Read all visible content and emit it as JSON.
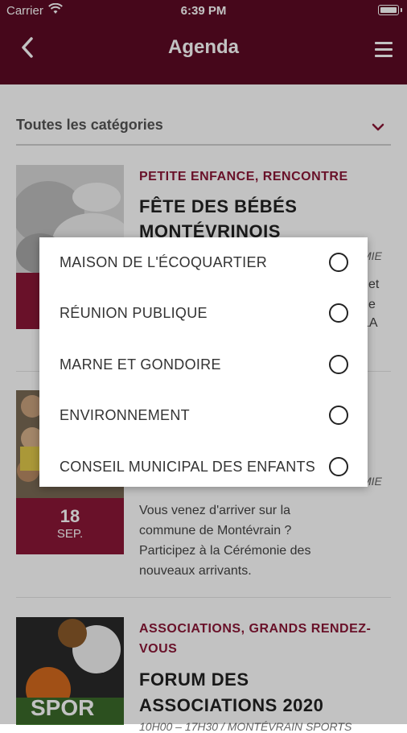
{
  "status_bar": {
    "carrier": "Carrier",
    "time": "6:39 PM"
  },
  "nav": {
    "back_icon": "chevron-left-icon",
    "title": "Agenda",
    "menu_icon": "hamburger-menu-icon"
  },
  "filter": {
    "label": "Toutes les catégories",
    "chevron": "⌄"
  },
  "events": [
    {
      "category": "PETITE ENFANCE, RENCONTRE",
      "title_line1": "FÊTE DES BÉBÉS",
      "title_line2": "MONTÉVRINOIS",
      "meta_fragment": "MIE",
      "desc_fragment_1": "et",
      "desc_fragment_2": "e",
      "desc_fragment_3": "LA"
    },
    {
      "meta_fragment": "MIE",
      "day": "18",
      "month": "SEP.",
      "desc": [
        "Vous venez d'arriver sur la",
        "commune de Montévrain ?",
        "Participez à la Cérémonie des",
        "nouveaux arrivants."
      ]
    },
    {
      "category_line1": "ASSOCIATIONS, GRANDS RENDEZ-",
      "category_line2": "VOUS",
      "title_line1": "FORUM DES",
      "title_line2": "ASSOCIATIONS 2020",
      "meta_fragment": "10H00 – 17H30 / MONTÉVRAIN SPORTS",
      "thumb_text": "SPOR"
    }
  ],
  "dialog": {
    "options": [
      {
        "label": "MAISON DE L'ÉCOQUARTIER",
        "selected": false
      },
      {
        "label": "RÉUNION PUBLIQUE",
        "selected": false
      },
      {
        "label": "MARNE ET GONDOIRE",
        "selected": false
      },
      {
        "label": "ENVIRONNEMENT",
        "selected": false
      },
      {
        "label": "CONSEIL MUNICIPAL DES ENFANTS",
        "selected": false
      }
    ]
  },
  "colors": {
    "brand": "#5c0a24",
    "accent": "#8b1737"
  }
}
